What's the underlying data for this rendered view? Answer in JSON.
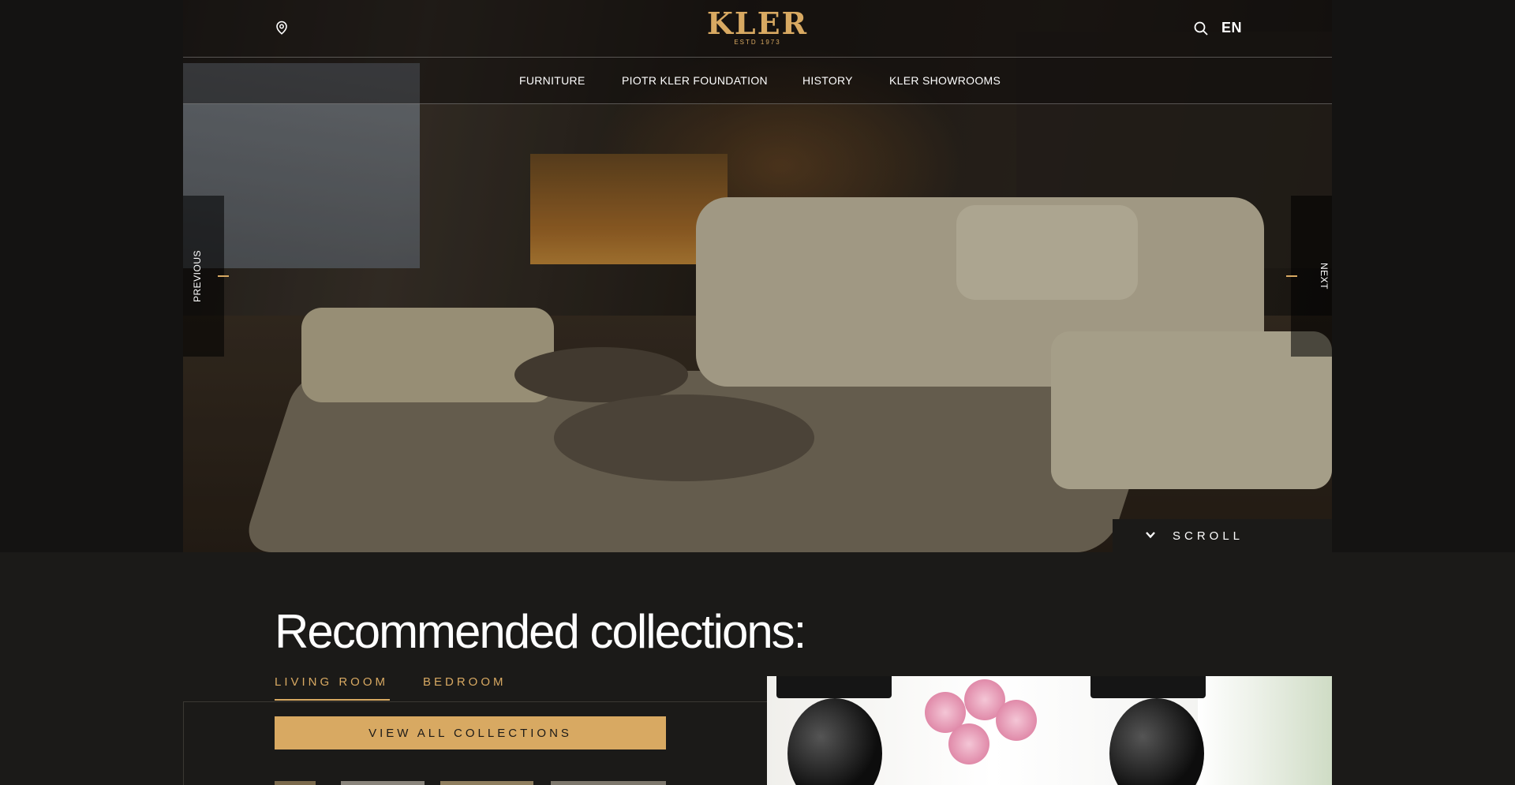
{
  "header": {
    "logo_name": "KLER",
    "logo_est": "ESTD 1973",
    "language": "EN",
    "nav": [
      "FURNITURE",
      "PIOTR KLER FOUNDATION",
      "HISTORY",
      "KLER SHOWROOMS"
    ]
  },
  "slider": {
    "previous_label": "PREVIOUS",
    "next_label": "NEXT",
    "scroll_label": "SCROLL"
  },
  "collections": {
    "title": "Recommended collections:",
    "tabs": [
      "LIVING ROOM",
      "BEDROOM"
    ],
    "active_tab": "LIVING ROOM",
    "view_all_label": "VIEW ALL COLLECTIONS"
  },
  "colors": {
    "accent_gold": "#d8a962",
    "background": "#1b1a18"
  },
  "icons": [
    "map-pin-icon",
    "search-icon",
    "chevron-down-icon"
  ]
}
